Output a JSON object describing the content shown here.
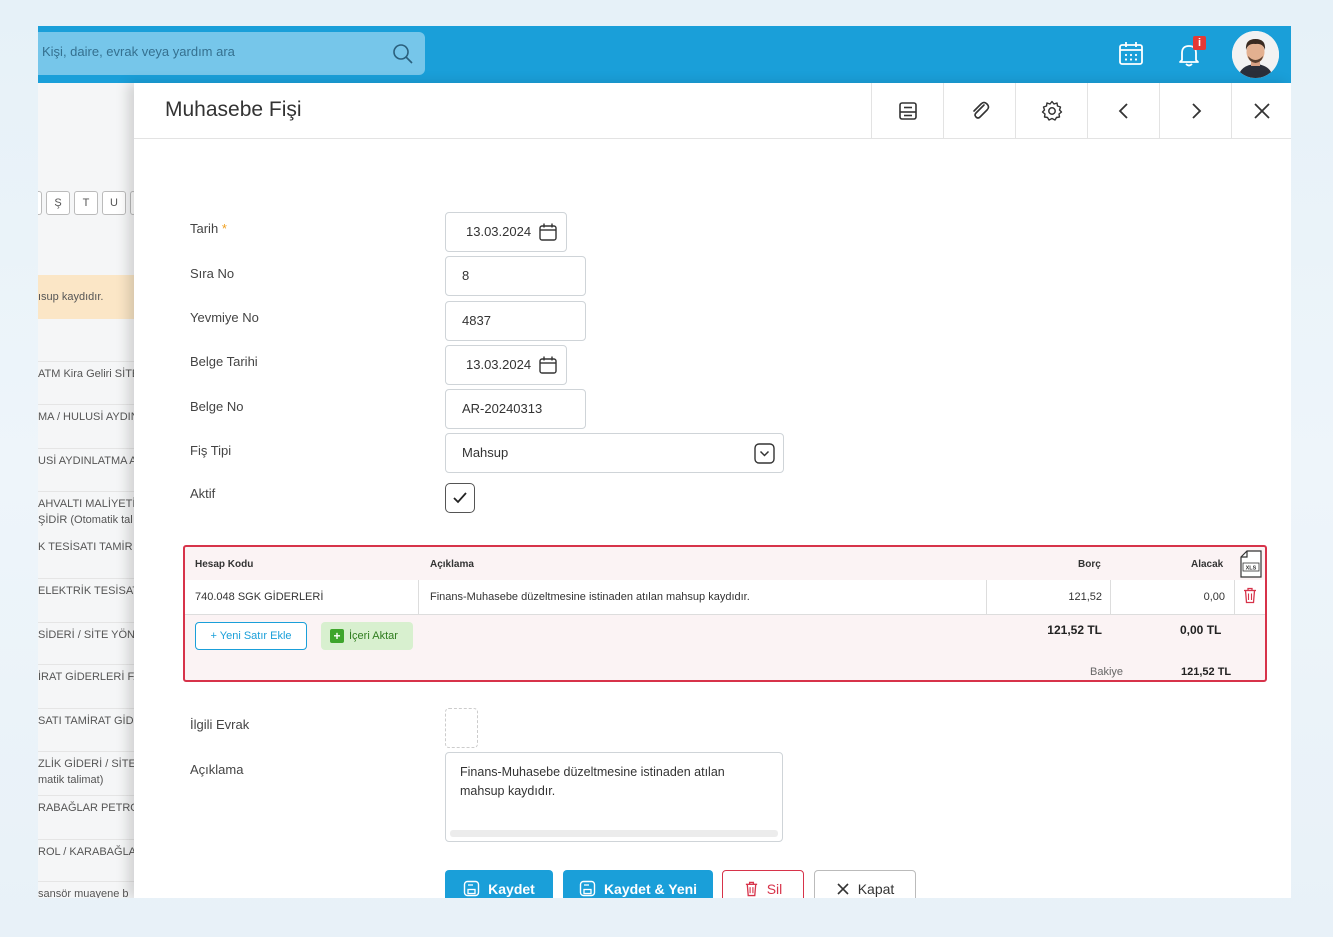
{
  "topbar": {
    "search_placeholder": "Kişi, daire, evrak veya yardım ara",
    "notification_count": "i"
  },
  "background_page": {
    "letters": [
      "Ş",
      "T",
      "U"
    ],
    "notice": "ısup kaydıdır.",
    "rows": [
      "ATM Kira Geliri SİTE",
      "MA / HULUSİ AYDIN",
      "USİ AYDINLATMA A",
      "AHVALTI MALİYETİ",
      "ŞİDİR (Otomatik tal",
      "K TESİSATI TAMİR",
      "ELEKTRİK TESİSAT",
      "SİDERİ / SİTE YÖNE",
      "İRAT GİDERLERİ FA",
      "SATI TAMİRAT GİDE",
      "ZLİK GİDERİ / SİTE",
      "matik talimat)",
      "RABAĞLAR PETRO",
      "ROL / KARABAĞLA",
      "sansör muayene b"
    ]
  },
  "panel": {
    "title": "Muhasebe Fişi"
  },
  "form": {
    "tarih_label": "Tarih",
    "tarih_required": "*",
    "tarih_value": "13.03.2024",
    "sira_label": "Sıra No",
    "sira_value": "8",
    "yevmiye_label": "Yevmiye No",
    "yevmiye_value": "4837",
    "belge_tarihi_label": "Belge Tarihi",
    "belge_tarihi_value": "13.03.2024",
    "belge_no_label": "Belge No",
    "belge_no_value": "AR-20240313",
    "fis_tipi_label": "Fiş Tipi",
    "fis_tipi_value": "Mahsup",
    "aktif_label": "Aktif",
    "ilgili_evrak_label": "İlgili Evrak",
    "aciklama_label": "Açıklama",
    "aciklama_value": "Finans-Muhasebe düzeltmesine istinaden atılan mahsup kaydıdır."
  },
  "table": {
    "headers": {
      "hesap_kodu": "Hesap Kodu",
      "aciklama": "Açıklama",
      "borc": "Borç",
      "alacak": "Alacak"
    },
    "rows": [
      {
        "hesap_kodu": "740.048 SGK GİDERLERİ",
        "aciklama": "Finans-Muhasebe düzeltmesine istinaden atılan mahsup kaydıdır.",
        "borc": "121,52",
        "alacak": "0,00"
      }
    ],
    "add_row_label": "Yeni Satır Ekle",
    "import_label": "İçeri Aktar",
    "total_borc": "121,52 TL",
    "total_alacak": "0,00 TL",
    "bakiye_label": "Bakiye",
    "bakiye_value": "121,52 TL"
  },
  "actions": {
    "save": "Kaydet",
    "save_new": "Kaydet & Yeni",
    "delete": "Sil",
    "close": "Kapat"
  },
  "colors": {
    "primary": "#1a9fd9",
    "danger": "#d7334a"
  }
}
